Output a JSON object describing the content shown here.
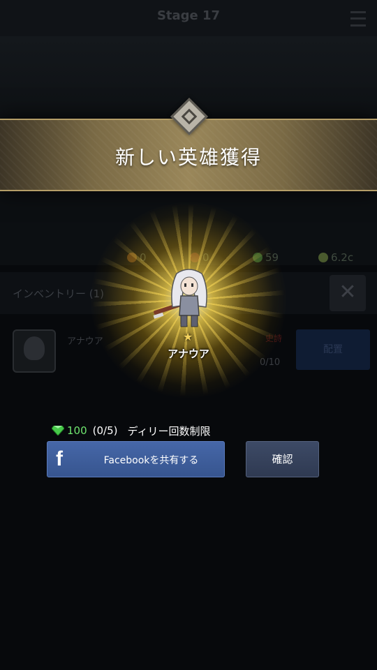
{
  "background": {
    "stage_label": "Stage 17",
    "resources": [
      {
        "icon": "orange-orb-icon",
        "value": "0",
        "color": "#5a3a1a"
      },
      {
        "icon": "red-orb-icon",
        "value": "0",
        "color": "#4a1e1e"
      },
      {
        "icon": "gem-icon",
        "value": "59",
        "color": "#2e5a2e"
      },
      {
        "icon": "potion-icon",
        "value": "6.2c",
        "color": "#4a5a2e"
      }
    ],
    "inventory_title": "インベントリー (1)",
    "close_glyph": "✕",
    "hero_name": "アナウア",
    "red_mark": "史詩",
    "count": "0/10",
    "place_label": "配置"
  },
  "banner": {
    "title": "新しい英雄獲得"
  },
  "hero": {
    "star": "★",
    "name": "アナウア"
  },
  "reward": {
    "gem_icon": "gem-icon",
    "amount": "100",
    "count": "(0/5)",
    "label": "ディリー回数制限"
  },
  "buttons": {
    "facebook_icon": "f",
    "facebook_label": "Facebookを共有する",
    "confirm_label": "確認"
  },
  "colors": {
    "banner_gold": "#9a875a",
    "reward_green": "#6fe56f",
    "facebook_blue": "#4667a8",
    "confirm_slate": "#3d4a66"
  }
}
